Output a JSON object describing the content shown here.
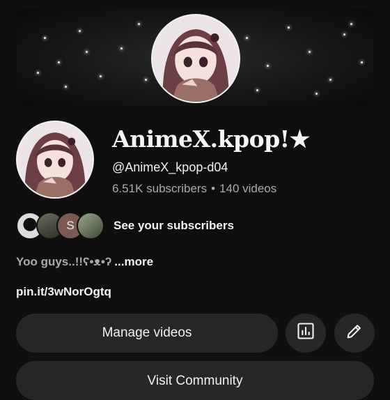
{
  "channel": {
    "name": "AnimeX.kpop!★",
    "handle": "@AnimeX_kpop-d04",
    "subscribers": "6.51K subscribers",
    "separator": "•",
    "videos": "140 videos"
  },
  "subscribers_row": {
    "label": "See your subscribers",
    "avatars": [
      {
        "kind": "image",
        "name": "subscriber-avatar-1"
      },
      {
        "kind": "image",
        "name": "subscriber-avatar-2"
      },
      {
        "kind": "letter",
        "letter": "S",
        "color": "#7a5a52"
      },
      {
        "kind": "image",
        "name": "subscriber-avatar-4"
      }
    ]
  },
  "description": {
    "text": "Yoo guys..!!ʕ•ᴥ•ʔ",
    "more_label": "...more"
  },
  "link": "pin.it/3wNorOgtq",
  "actions": {
    "manage_label": "Manage videos",
    "stats_icon": "analytics-icon",
    "edit_icon": "pencil-icon",
    "community_label": "Visit Community"
  },
  "colors": {
    "background": "#0f0f0f",
    "button": "#272727",
    "secondary_text": "#aaaaaa"
  }
}
